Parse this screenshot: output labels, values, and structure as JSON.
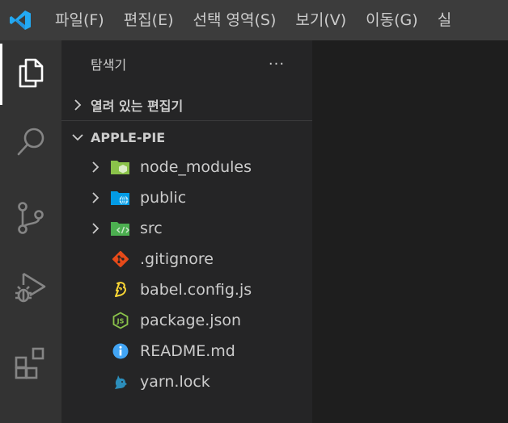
{
  "titlebar": {
    "menu": [
      {
        "label": "파일(F)"
      },
      {
        "label": "편집(E)"
      },
      {
        "label": "선택 영역(S)"
      },
      {
        "label": "보기(V)"
      },
      {
        "label": "이동(G)"
      },
      {
        "label": "실"
      }
    ]
  },
  "activitybar": {
    "items": [
      {
        "name": "explorer",
        "icon": "files-icon",
        "active": true
      },
      {
        "name": "search",
        "icon": "search-icon"
      },
      {
        "name": "source-control",
        "icon": "source-control-icon"
      },
      {
        "name": "run-debug",
        "icon": "run-debug-icon"
      },
      {
        "name": "extensions",
        "icon": "extensions-icon"
      }
    ]
  },
  "sidebar": {
    "title": "탐색기",
    "more": "···",
    "open_editors_label": "열려 있는 편집기",
    "root_label": "APPLE-PIE",
    "items": [
      {
        "name": "node_modules",
        "type": "folder",
        "icon": "node-folder-icon",
        "color": "#8bc34a"
      },
      {
        "name": "public",
        "type": "folder",
        "icon": "public-folder-icon",
        "color": "#039be5"
      },
      {
        "name": "src",
        "type": "folder",
        "icon": "src-folder-icon",
        "color": "#4caf50"
      },
      {
        "name": ".gitignore",
        "type": "file",
        "icon": "git-icon",
        "color": "#e64a19"
      },
      {
        "name": "babel.config.js",
        "type": "file",
        "icon": "babel-icon",
        "color": "#fdd835"
      },
      {
        "name": "package.json",
        "type": "file",
        "icon": "nodejs-icon",
        "color": "#8bc34a"
      },
      {
        "name": "README.md",
        "type": "file",
        "icon": "info-icon",
        "color": "#42a5f5"
      },
      {
        "name": "yarn.lock",
        "type": "file",
        "icon": "yarn-icon",
        "color": "#2c8ebb"
      }
    ]
  }
}
